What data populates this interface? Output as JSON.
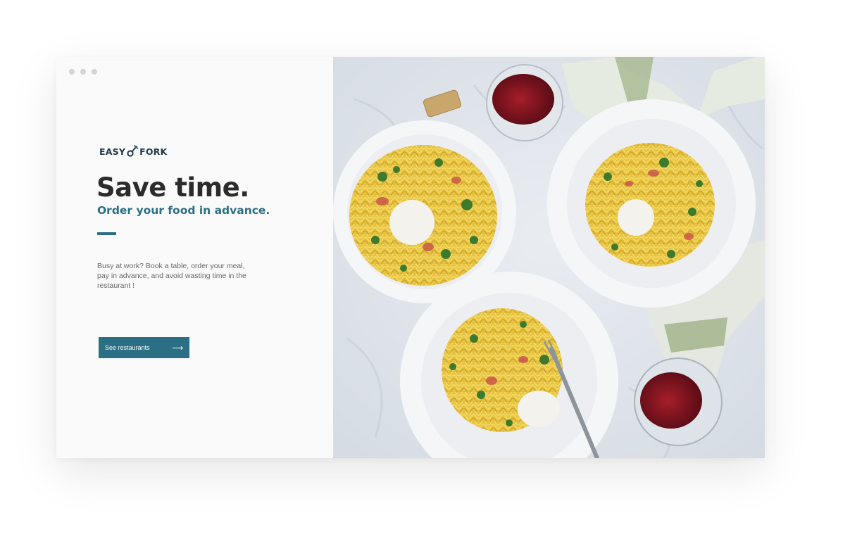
{
  "window": {
    "dots": [
      "",
      "",
      ""
    ]
  },
  "brand": {
    "name_left": "EASY",
    "name_right": "FORK",
    "logo_icon": "fork-icon",
    "color": "#243848"
  },
  "hero": {
    "headline": "Save time.",
    "subheadline": "Order your food in advance.",
    "description": "Busy at work? Book a table, order your meal, pay in advance, and avoid wasting time in the restaurant !",
    "cta_label": "See restaurants",
    "cta_icon": "arrow-right-icon",
    "accent_color": "#2b6f84",
    "image_subject": "pasta-dishes-photo"
  }
}
